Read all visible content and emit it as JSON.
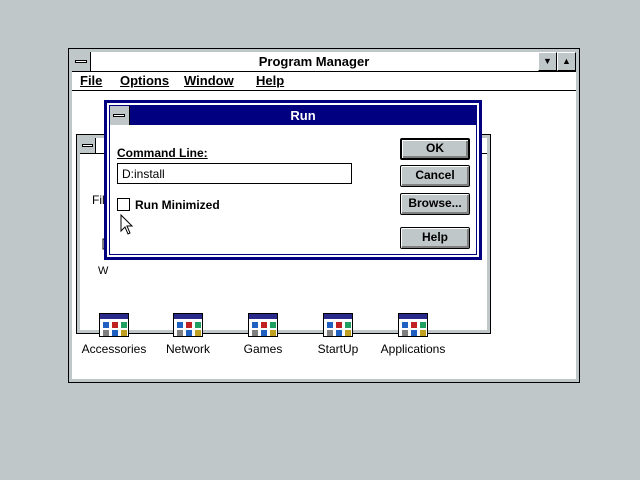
{
  "program_manager": {
    "title": "Program Manager",
    "menu": [
      "File",
      "Options",
      "Window",
      "Help"
    ],
    "minimize_glyph": "▼",
    "maximize_glyph": "▲"
  },
  "main_group": {
    "visible_text_file": "File",
    "visible_text_w": "W"
  },
  "group_icons": [
    {
      "label": "Accessories"
    },
    {
      "label": "Network"
    },
    {
      "label": "Games"
    },
    {
      "label": "StartUp"
    },
    {
      "label": "Applications"
    }
  ],
  "run_dialog": {
    "title": "Run",
    "command_line_label": "Command Line:",
    "command_line_value": "D:install",
    "run_minimized_label": "Run Minimized",
    "run_minimized_checked": false,
    "buttons": {
      "ok": "OK",
      "cancel": "Cancel",
      "browse": "Browse...",
      "help": "Help"
    }
  },
  "colors": {
    "desktop": "#c0c7c8",
    "active_title": "#000080",
    "window_bg": "#ffffff"
  }
}
